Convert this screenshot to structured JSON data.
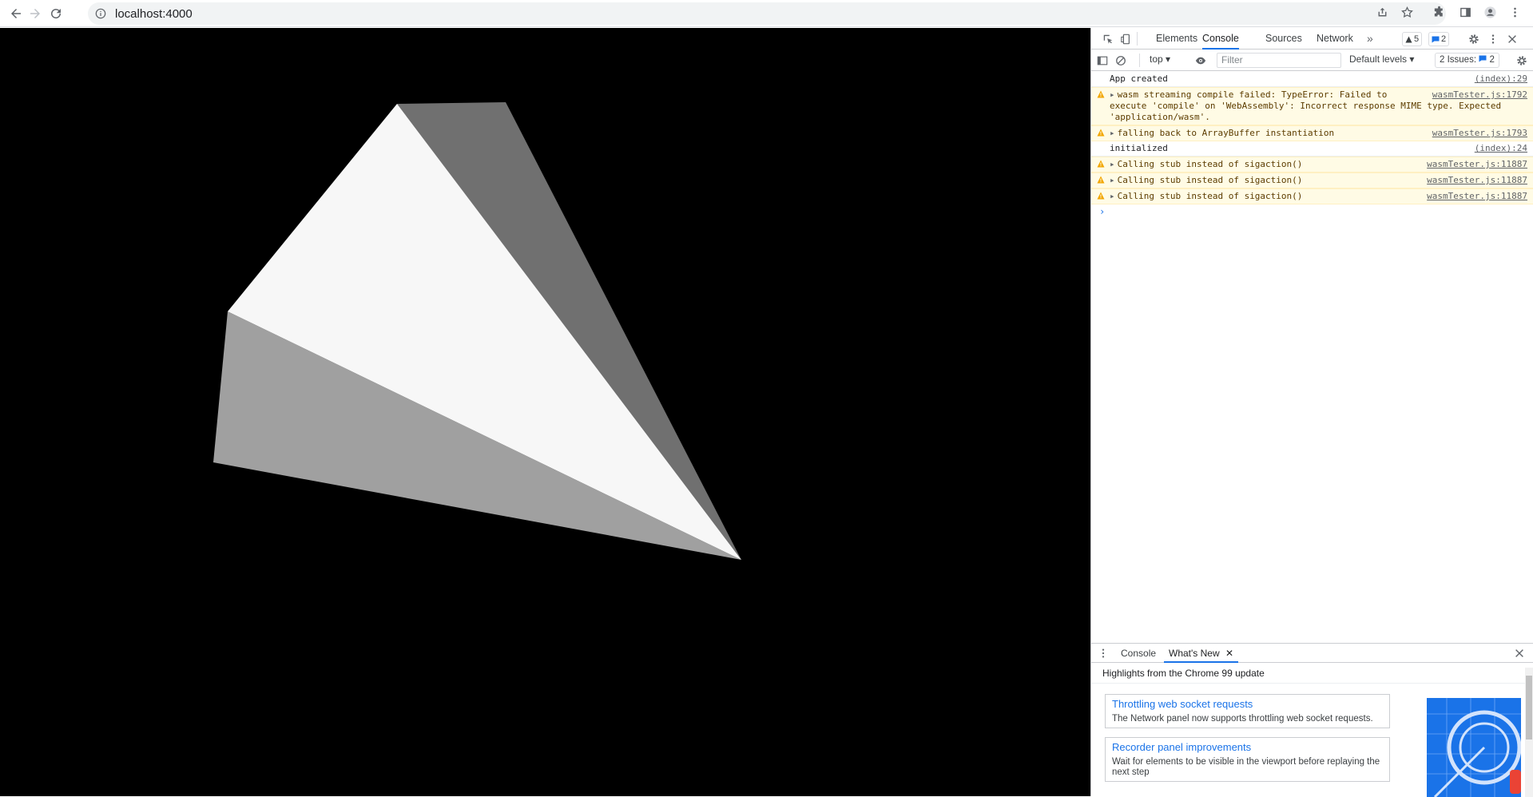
{
  "browser": {
    "url": "localhost:4000"
  },
  "devtools": {
    "tabs": [
      "Elements",
      "Console",
      "Sources",
      "Network"
    ],
    "active_tab": "Console",
    "warnings_count": "5",
    "messages_count": "2",
    "context": "top",
    "filter_placeholder": "Filter",
    "levels": "Default levels",
    "issues_label": "2 Issues:",
    "issues_count": "2",
    "console_messages": [
      {
        "type": "info",
        "text": "App created",
        "source": "(index):29"
      },
      {
        "type": "warn",
        "text": "wasm streaming compile failed: TypeError: Failed to execute 'compile' on 'WebAssembly': Incorrect response MIME type. Expected 'application/wasm'.",
        "source": "wasmTester.js:1792"
      },
      {
        "type": "warn",
        "text": "falling back to ArrayBuffer instantiation",
        "source": "wasmTester.js:1793"
      },
      {
        "type": "info",
        "text": "initialized",
        "source": "(index):24"
      },
      {
        "type": "warn",
        "text": "Calling stub instead of sigaction()",
        "source": "wasmTester.js:11887"
      },
      {
        "type": "warn",
        "text": "Calling stub instead of sigaction()",
        "source": "wasmTester.js:11887"
      },
      {
        "type": "warn",
        "text": "Calling stub instead of sigaction()",
        "source": "wasmTester.js:11887"
      }
    ],
    "prompt": "›",
    "drawer": {
      "tabs": [
        "Console",
        "What's New"
      ],
      "header": "Highlights from the Chrome 99 update",
      "cards": [
        {
          "title": "Throttling web socket requests",
          "desc": "The Network panel now supports throttling web socket requests."
        },
        {
          "title": "Recorder panel improvements",
          "desc": "Wait for elements to be visible in the viewport before replaying the next step"
        }
      ]
    }
  },
  "colors": {
    "canvas_bg": "#000000",
    "face_front": "#f7f7f7",
    "face_right": "#707070",
    "face_bottom": "#a0a0a0",
    "accent": "#1a73e8",
    "warn_bg": "#fffbe5"
  }
}
